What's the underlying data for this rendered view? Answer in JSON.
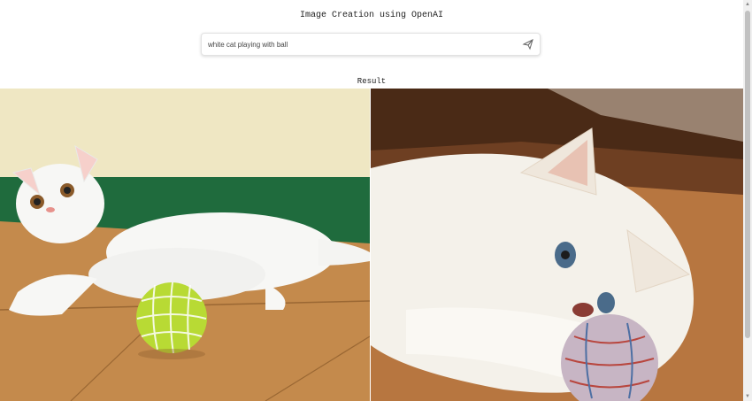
{
  "header": {
    "title": "Image Creation using OpenAI"
  },
  "prompt": {
    "value": "white cat playing with ball",
    "send_icon": "send-icon"
  },
  "results": {
    "label": "Result",
    "images": [
      {
        "icon": "generated-image-1"
      },
      {
        "icon": "generated-image-2"
      }
    ]
  },
  "colors": {
    "background": "#ffffff",
    "text": "#222222",
    "border": "#e2e2e2"
  }
}
